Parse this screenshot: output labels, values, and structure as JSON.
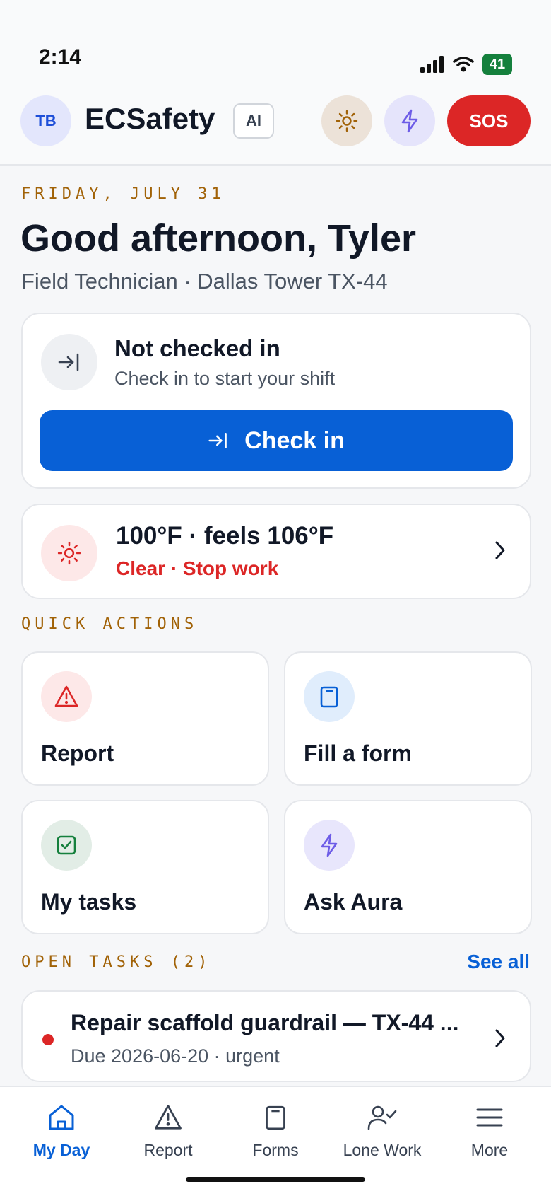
{
  "status_bar": {
    "time": "2:14",
    "battery": "41"
  },
  "header": {
    "avatar_initials": "TB",
    "app_name": "ECSafety",
    "ai_badge": "AI",
    "sos_label": "SOS"
  },
  "greeting": {
    "date": "FRIDAY, JULY 31",
    "title": "Good afternoon, Tyler",
    "role": "Field Technician · Dallas Tower TX-44"
  },
  "checkin": {
    "title": "Not checked in",
    "subtitle": "Check in to start your shift",
    "button_label": "Check in"
  },
  "weather": {
    "temperature": "100°F · feels 106°F",
    "status": "Clear · Stop work"
  },
  "quick_actions": {
    "label": "QUICK ACTIONS",
    "items": [
      {
        "label": "Report",
        "icon": "warning-icon"
      },
      {
        "label": "Fill a form",
        "icon": "clipboard-icon"
      },
      {
        "label": "My tasks",
        "icon": "checkbox-icon"
      },
      {
        "label": "Ask Aura",
        "icon": "bolt-icon"
      }
    ]
  },
  "open_tasks": {
    "label": "OPEN TASKS (2)",
    "see_all": "See all",
    "items": [
      {
        "title": "Repair scaffold guardrail — TX-44 ...",
        "meta": "Due 2026-06-20 · urgent"
      }
    ]
  },
  "tab_bar": {
    "items": [
      {
        "label": "My Day",
        "active": true
      },
      {
        "label": "Report"
      },
      {
        "label": "Forms"
      },
      {
        "label": "Lone Work"
      },
      {
        "label": "More"
      }
    ]
  },
  "colors": {
    "primary": "#0860d6",
    "danger": "#dc2626",
    "accent_label": "#a16207"
  }
}
